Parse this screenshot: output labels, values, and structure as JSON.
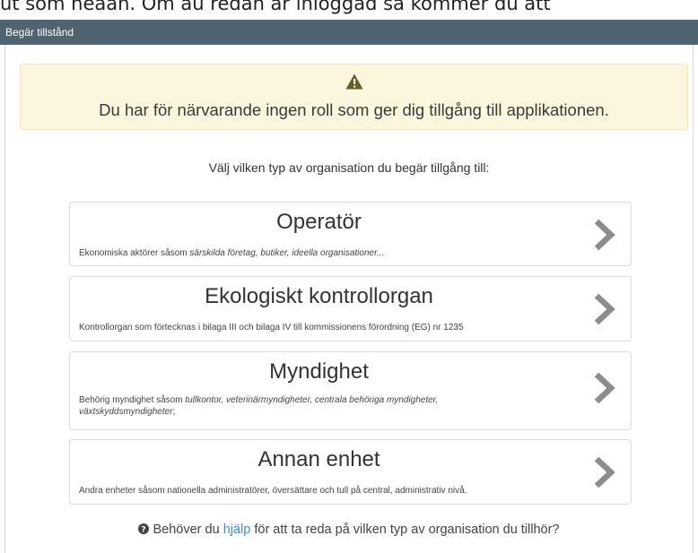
{
  "top_strip_text": "ut som neaan. Om au redan ar inioggad sa kommer du att",
  "header": {
    "title": "Begär tillstånd"
  },
  "alert": {
    "message": "Du har för närvarande ingen roll som ger dig tillgång till applikationen.",
    "icon": "warning-triangle-icon"
  },
  "prompt": "Välj vilken typ av organisation du begär tillgång till:",
  "options": [
    {
      "title": "Operatör",
      "desc_plain": "Ekonomiska aktörer såsom ",
      "desc_italic": "särskilda företag, butiker, ideella organisationer...",
      "desc_tail": ""
    },
    {
      "title": "Ekologiskt kontrollorgan",
      "desc_plain": "Kontrollorgan som förtecknas i bilaga III och bilaga IV till kommissionens förordning (EG) nr 1235",
      "desc_italic": "",
      "desc_tail": ""
    },
    {
      "title": "Myndighet",
      "desc_plain": "Behörig myndighet såsom ",
      "desc_italic": "tullkontor, veterinärmyndigheter, centrala behöriga myndigheter, växtskyddsmyndigheter",
      "desc_tail": ";"
    },
    {
      "title": "Annan enhet",
      "desc_plain": "Andra enheter såsom nationella administratörer, översättare och tull på central, administrativ nivå.",
      "desc_italic": "",
      "desc_tail": ""
    }
  ],
  "help": {
    "before": "Behöver du ",
    "link": "hjälp",
    "after": " för att ta reda på vilken typ av organisation du tillhör?"
  },
  "colors": {
    "header_bg": "#4f6370",
    "alert_bg": "#fcf6de",
    "link": "#3f8fcf",
    "chevron": "#8c8c8c"
  }
}
